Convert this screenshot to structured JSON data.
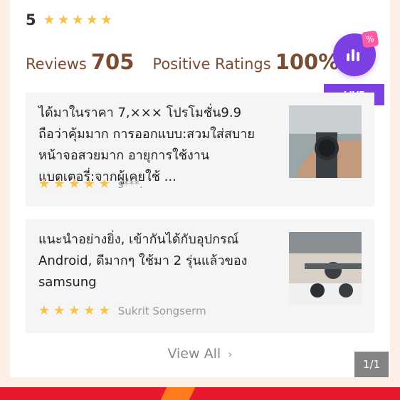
{
  "rating": {
    "score": "5",
    "stars": 5
  },
  "stats": {
    "reviews_label": "Reviews",
    "reviews_value": "705",
    "positive_label": "Positive Ratings",
    "positive_value": "100%"
  },
  "live": {
    "label": "LIVE",
    "icon": "live-chart-icon"
  },
  "reviews": [
    {
      "text": "ได้มาในราคา 7,××× โปรโมชั่น9.9 ถือว่าคุ้มมาก การออกแบบ:สวมใส่สบาย หน้าจอสวยมาก อายุการใช้งานแบตเตอรี่:จากผู้เคยใช้ ...",
      "stars": 5,
      "user": "s***."
    },
    {
      "text": "แนะนำอย่างยิ่ง, เข้ากันได้กับอุปกรณ์ Android, ดีมากๆ ใช้มา 2 รุ่นแล้วของ samsung",
      "stars": 5,
      "user": "Sukrit Songserm"
    }
  ],
  "view_all": {
    "label": "View All"
  },
  "page_indicator": "1/1",
  "colors": {
    "star": "#f4c24d",
    "accent_purple": "#7b3fe4",
    "stat_brown": "#7a4c32",
    "flash_red": "#e8192c"
  }
}
